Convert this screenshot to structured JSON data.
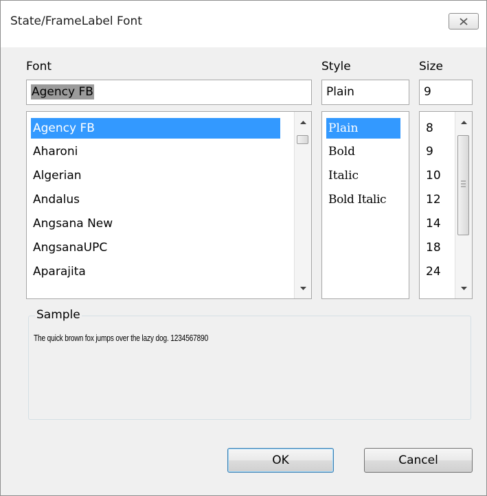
{
  "window": {
    "title": "State/FrameLabel Font"
  },
  "font": {
    "label": "Font",
    "value": "Agency FB",
    "items": [
      "Agency FB",
      "Aharoni",
      "Algerian",
      "Andalus",
      "Angsana New",
      "AngsanaUPC",
      "Aparajita"
    ],
    "selected_index": 0
  },
  "style": {
    "label": "Style",
    "value": "Plain",
    "items": [
      "Plain",
      "Bold",
      "Italic",
      "Bold Italic"
    ],
    "selected_index": 0
  },
  "size": {
    "label": "Size",
    "value": "9",
    "items": [
      "8",
      "9",
      "10",
      "12",
      "14",
      "18",
      "24"
    ]
  },
  "sample": {
    "label": "Sample",
    "text": "The quick brown fox jumps over the lazy dog.  1234567890"
  },
  "buttons": {
    "ok": "OK",
    "cancel": "Cancel"
  },
  "colors": {
    "selection": "#3399ff",
    "default_button_border": "#3c7fb1"
  },
  "icons": {
    "close": "close-icon",
    "scroll_up": "scroll-up-arrow-icon",
    "scroll_down": "scroll-down-arrow-icon"
  }
}
